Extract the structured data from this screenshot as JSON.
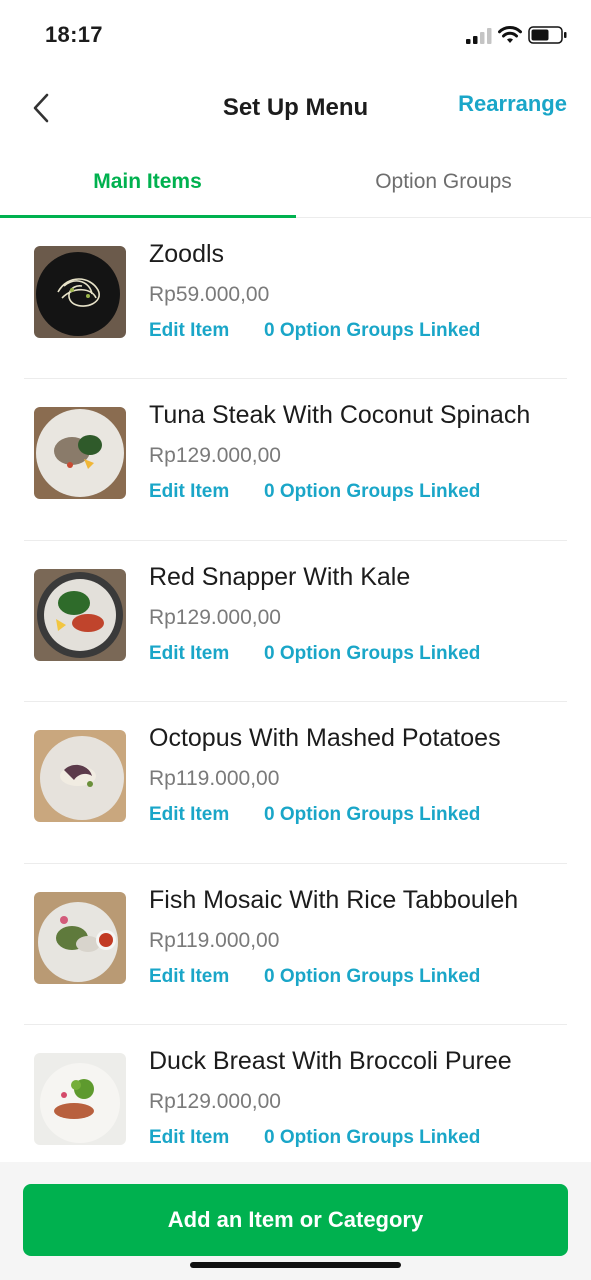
{
  "status_bar": {
    "time": "18:17",
    "icons": [
      "cellular-signal-icon",
      "wifi-icon",
      "battery-icon"
    ]
  },
  "header": {
    "title": "Set Up Menu",
    "rearrange_label": "Rearrange",
    "back_icon": "chevron-left-icon"
  },
  "tabs": [
    {
      "label": "Main Items",
      "active": true
    },
    {
      "label": "Option Groups",
      "active": false
    }
  ],
  "items": [
    {
      "name": "Zoodls",
      "price": "Rp59.000,00",
      "edit_label": "Edit Item",
      "options_label": "0 Option Groups Linked"
    },
    {
      "name": "Tuna Steak With Coconut Spinach",
      "price": "Rp129.000,00",
      "edit_label": "Edit Item",
      "options_label": "0 Option Groups Linked"
    },
    {
      "name": "Red Snapper With Kale",
      "price": "Rp129.000,00",
      "edit_label": "Edit Item",
      "options_label": "0 Option Groups Linked"
    },
    {
      "name": "Octopus With Mashed Potatoes",
      "price": "Rp119.000,00",
      "edit_label": "Edit Item",
      "options_label": "0 Option Groups Linked"
    },
    {
      "name": "Fish Mosaic With Rice Tabbouleh",
      "price": "Rp119.000,00",
      "edit_label": "Edit Item",
      "options_label": "0 Option Groups Linked"
    },
    {
      "name": "Duck Breast With Broccoli Puree",
      "price": "Rp129.000,00",
      "edit_label": "Edit Item",
      "options_label": "0 Option Groups Linked"
    }
  ],
  "footer": {
    "add_label": "Add an Item or Category"
  },
  "colors": {
    "accent_green": "#00b14f",
    "link_blue": "#1aa6c8",
    "price_gray": "#7a7a7a"
  }
}
